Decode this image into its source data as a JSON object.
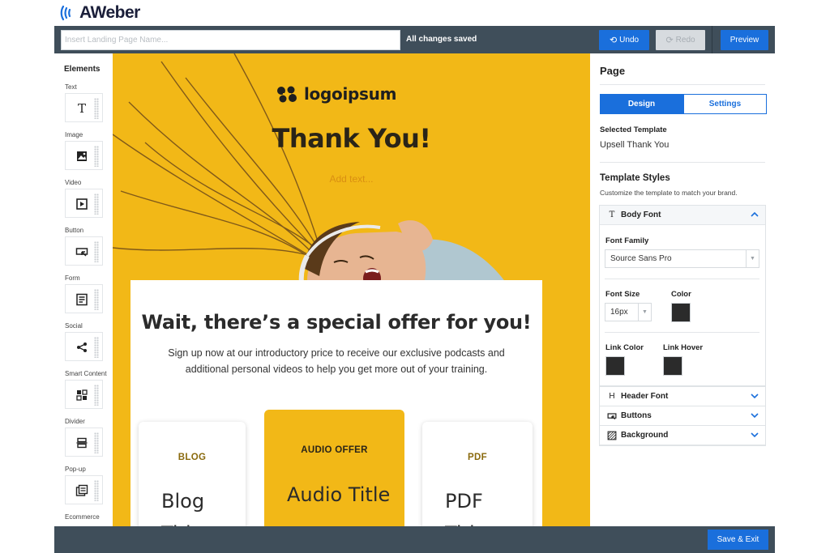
{
  "app": {
    "logo_text": "AWeber"
  },
  "topbar": {
    "name_placeholder": "Insert Landing Page Name...",
    "name_value": "",
    "status": "All changes saved",
    "undo_label": "Undo",
    "redo_label": "Redo",
    "preview_label": "Preview"
  },
  "elements": {
    "title": "Elements",
    "items": [
      {
        "label": "Text",
        "icon": "text-icon"
      },
      {
        "label": "Image",
        "icon": "image-icon"
      },
      {
        "label": "Video",
        "icon": "video-icon"
      },
      {
        "label": "Button",
        "icon": "button-icon"
      },
      {
        "label": "Form",
        "icon": "form-icon"
      },
      {
        "label": "Social",
        "icon": "share-icon"
      },
      {
        "label": "Smart Content",
        "icon": "smart-content-icon"
      },
      {
        "label": "Divider",
        "icon": "divider-icon"
      },
      {
        "label": "Pop-up",
        "icon": "popup-icon"
      },
      {
        "label": "Ecommerce",
        "icon": "ecommerce-icon"
      }
    ]
  },
  "canvas": {
    "brand_text": "logoipsum",
    "hero_title": "Thank You!",
    "hero_sub": "Add text...",
    "offer_title": "Wait, there’s a special offer for you!",
    "offer_desc": "Sign up now at our introductory price to receive our exclusive podcasts and additional personal videos to help you get more out of your training.",
    "products": [
      {
        "tag": "BLOG",
        "title": "Blog Title"
      },
      {
        "tag": "AUDIO OFFER",
        "title": "Audio Title"
      },
      {
        "tag": "PDF",
        "title": "PDF Title"
      }
    ],
    "colors": {
      "background": "#f2b817",
      "card": "#ffffff"
    }
  },
  "panel": {
    "title": "Page",
    "tab_design": "Design",
    "tab_settings": "Settings",
    "selected_template_label": "Selected Template",
    "selected_template_value": "Upsell Thank You",
    "styles_title": "Template Styles",
    "styles_desc": "Customize the template to match your brand.",
    "body_font": {
      "title": "Body Font",
      "font_family_label": "Font Family",
      "font_family_value": "Source Sans Pro",
      "font_size_label": "Font Size",
      "font_size_value": "16px",
      "color_label": "Color",
      "color_value": "#2b2b2b",
      "link_color_label": "Link Color",
      "link_hover_label": "Link Hover",
      "link_color_value": "#2b2b2b",
      "link_hover_value": "#2b2b2b"
    },
    "sections": [
      {
        "title": "Header Font",
        "icon": "header-icon"
      },
      {
        "title": "Buttons",
        "icon": "button-icon"
      },
      {
        "title": "Background",
        "icon": "background-icon"
      }
    ]
  },
  "bottombar": {
    "save_exit_label": "Save & Exit"
  },
  "theme": {
    "accent": "#1a6fdc",
    "bar": "#3f4e5a"
  }
}
